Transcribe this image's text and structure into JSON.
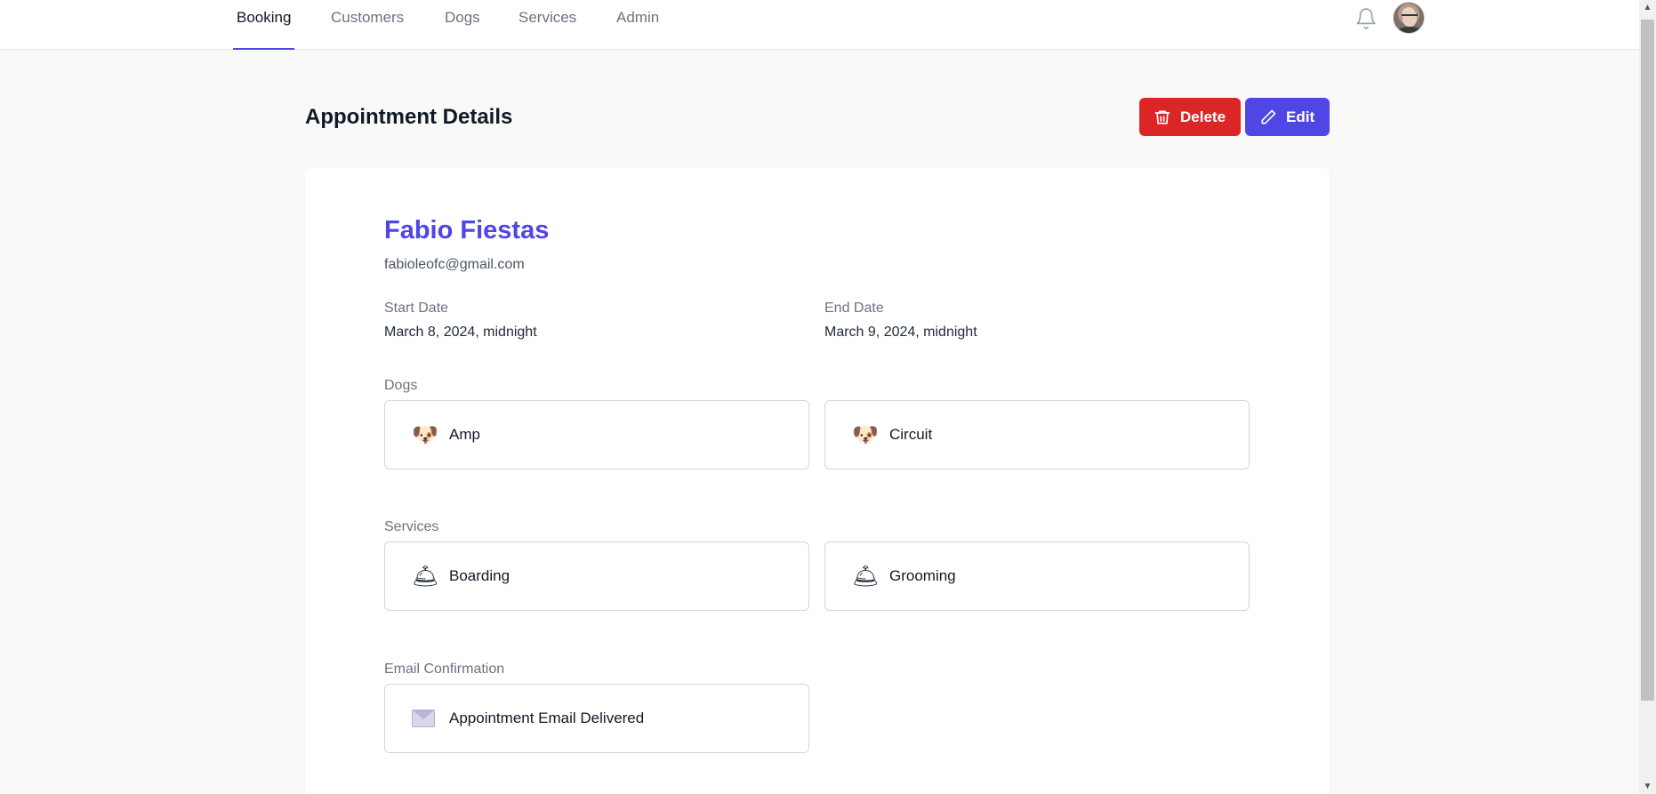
{
  "nav": {
    "tabs": [
      {
        "label": "Booking",
        "active": true
      },
      {
        "label": "Customers",
        "active": false
      },
      {
        "label": "Dogs",
        "active": false
      },
      {
        "label": "Services",
        "active": false
      },
      {
        "label": "Admin",
        "active": false
      }
    ],
    "icons": {
      "notifications": "bell-icon",
      "profile": "avatar"
    }
  },
  "header": {
    "title": "Appointment Details",
    "delete_label": "Delete",
    "edit_label": "Edit"
  },
  "appointment": {
    "customer_name": "Fabio Fiestas",
    "customer_email": "fabioleofc@gmail.com",
    "start_label": "Start Date",
    "start_value": "March 8, 2024, midnight",
    "end_label": "End Date",
    "end_value": "March 9, 2024, midnight",
    "dogs_label": "Dogs",
    "dogs": [
      {
        "name": "Amp",
        "icon": "dog-face-icon"
      },
      {
        "name": "Circuit",
        "icon": "dog-face-icon"
      }
    ],
    "services_label": "Services",
    "services": [
      {
        "name": "Boarding",
        "icon": "bellhop-bell-icon"
      },
      {
        "name": "Grooming",
        "icon": "bellhop-bell-icon"
      }
    ],
    "email_label": "Email Confirmation",
    "email_status": "Appointment Email Delivered",
    "email_icon": "envelope-icon"
  },
  "colors": {
    "accent": "#4f46e5",
    "danger": "#dc2626",
    "background": "#f9f9f8"
  }
}
